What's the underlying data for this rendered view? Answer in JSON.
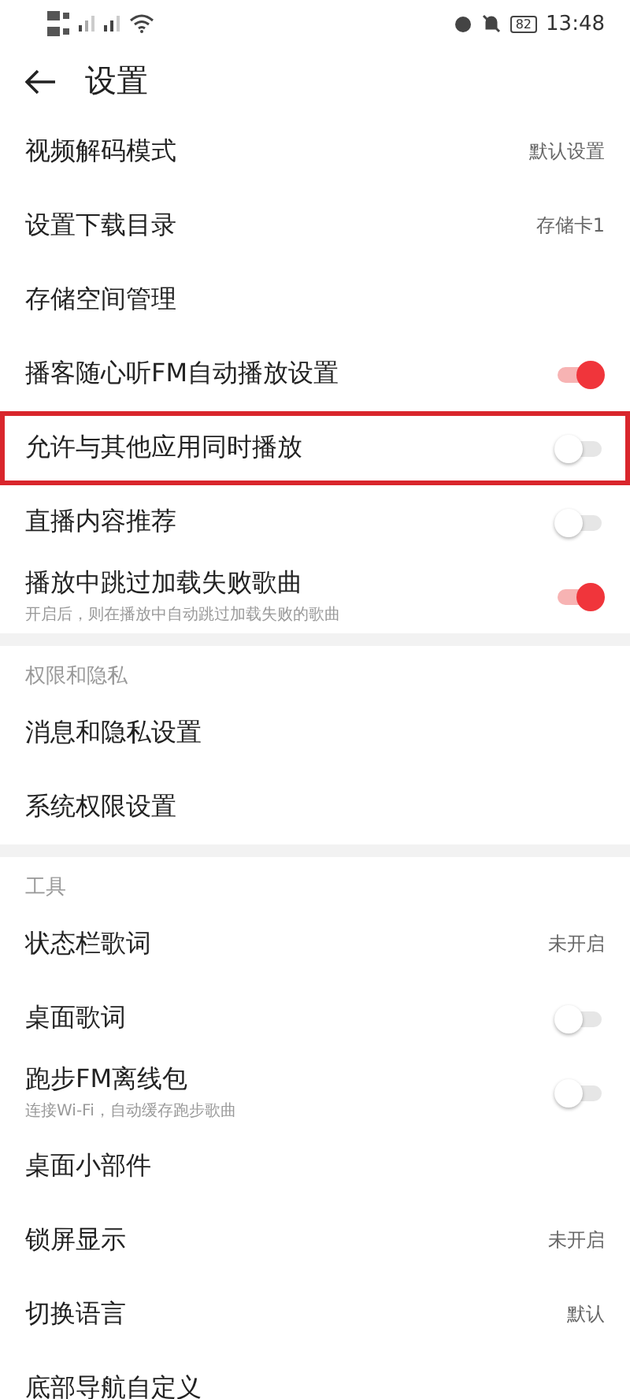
{
  "status_bar": {
    "time": "13:48",
    "battery": "82"
  },
  "header": {
    "title": "设置"
  },
  "sections": [
    {
      "items": [
        {
          "kind": "value",
          "label": "视频解码模式",
          "value": "默认设置",
          "highlighted": false
        },
        {
          "kind": "value",
          "label": "设置下载目录",
          "value": "存储卡1",
          "highlighted": false
        },
        {
          "kind": "link",
          "label": "存储空间管理",
          "highlighted": false
        },
        {
          "kind": "toggle",
          "label": "播客随心听FM自动播放设置",
          "on": true,
          "highlighted": false
        },
        {
          "kind": "toggle",
          "label": "允许与其他应用同时播放",
          "on": false,
          "highlighted": true
        },
        {
          "kind": "toggle",
          "label": "直播内容推荐",
          "on": false,
          "highlighted": false
        },
        {
          "kind": "toggle",
          "label": "播放中跳过加载失败歌曲",
          "subtitle": "开启后，则在播放中自动跳过加载失败的歌曲",
          "on": true,
          "highlighted": false
        }
      ]
    },
    {
      "title": "权限和隐私",
      "items": [
        {
          "kind": "link",
          "label": "消息和隐私设置",
          "highlighted": false
        },
        {
          "kind": "link",
          "label": "系统权限设置",
          "highlighted": false
        }
      ]
    },
    {
      "title": "工具",
      "items": [
        {
          "kind": "value",
          "label": "状态栏歌词",
          "value": "未开启",
          "highlighted": false
        },
        {
          "kind": "toggle",
          "label": "桌面歌词",
          "on": false,
          "highlighted": false
        },
        {
          "kind": "toggle",
          "label": "跑步FM离线包",
          "subtitle": "连接Wi-Fi，自动缓存跑步歌曲",
          "on": false,
          "highlighted": false
        },
        {
          "kind": "link",
          "label": "桌面小部件",
          "highlighted": false
        },
        {
          "kind": "value",
          "label": "锁屏显示",
          "value": "未开启",
          "highlighted": false
        },
        {
          "kind": "value",
          "label": "切换语言",
          "value": "默认",
          "highlighted": false
        },
        {
          "kind": "link",
          "label": "底部导航自定义",
          "highlighted": false
        }
      ]
    }
  ]
}
